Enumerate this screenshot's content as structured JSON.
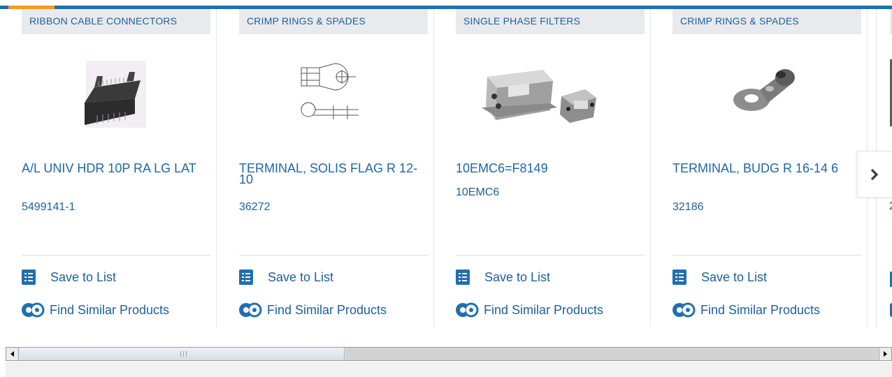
{
  "colors": {
    "brand_blue": "#1f6fb0",
    "accent_orange": "#f39a1f",
    "link_blue": "#1d66a8",
    "category_bg": "#e8eaed"
  },
  "actions": {
    "save_label": "Save to List",
    "similar_label": "Find Similar Products"
  },
  "products": [
    {
      "category": "RIBBON CABLE CONNECTORS",
      "title": "A/L UNIV HDR 10P RA LG LAT",
      "part_number": "5499141-1",
      "image_icon": "ribbon-connector-image"
    },
    {
      "category": "CRIMP RINGS & SPADES",
      "title": "TERMINAL, SOLIS FLAG R 12-10",
      "part_number": "36272",
      "image_icon": "flag-terminal-drawing"
    },
    {
      "category": "SINGLE PHASE FILTERS",
      "title": "10EMC6=F8149",
      "part_number": "10EMC6",
      "image_icon": "emc-filter-image"
    },
    {
      "category": "CRIMP RINGS & SPADES",
      "title": "TERMINAL, BUDG R 16-14 6",
      "part_number": "32186",
      "image_icon": "ring-terminal-image"
    }
  ],
  "partial_card": {
    "part_number_fragment": "2"
  },
  "carousel": {
    "next_icon": "chevron-right-icon"
  }
}
